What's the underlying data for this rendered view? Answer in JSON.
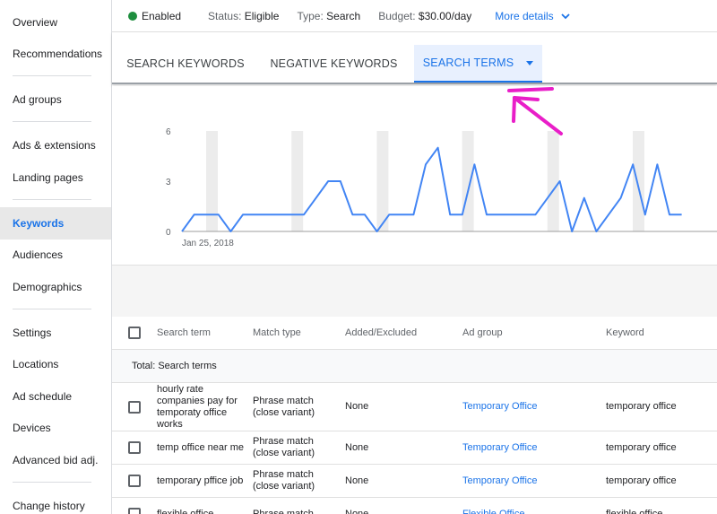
{
  "sidebar": {
    "items": [
      {
        "label": "Overview"
      },
      {
        "label": "Recommendations"
      },
      {
        "label": "Ad groups"
      },
      {
        "label": "Ads & extensions"
      },
      {
        "label": "Landing pages"
      },
      {
        "label": "Keywords"
      },
      {
        "label": "Audiences"
      },
      {
        "label": "Demographics"
      },
      {
        "label": "Settings"
      },
      {
        "label": "Locations"
      },
      {
        "label": "Ad schedule"
      },
      {
        "label": "Devices"
      },
      {
        "label": "Advanced bid adj."
      },
      {
        "label": "Change history"
      }
    ],
    "active": "Keywords"
  },
  "status": {
    "enabled": "Enabled",
    "status_label": "Status:",
    "status_value": "Eligible",
    "type_label": "Type:",
    "type_value": "Search",
    "budget_label": "Budget:",
    "budget_value": "$30.00/day",
    "more_details": "More details"
  },
  "tabs": [
    {
      "label": "SEARCH KEYWORDS"
    },
    {
      "label": "NEGATIVE KEYWORDS"
    },
    {
      "label": "SEARCH TERMS"
    }
  ],
  "chart_data": {
    "type": "line",
    "ylim": [
      0,
      6
    ],
    "y_ticks": [
      "0",
      "3",
      "6"
    ],
    "x_start_label": "Jan 25, 2018",
    "values": [
      0,
      1,
      1,
      1,
      0,
      1,
      1,
      1,
      1,
      1,
      1,
      2,
      3,
      3,
      1,
      1,
      0,
      1,
      1,
      1,
      4,
      5,
      1,
      1,
      4,
      1,
      1,
      1,
      1,
      1,
      2,
      3,
      0,
      2,
      0,
      1,
      2,
      4,
      1,
      4,
      1,
      1
    ],
    "color": "#4285f4"
  },
  "table": {
    "headers": {
      "search_term": "Search term",
      "match_type": "Match type",
      "added_excluded": "Added/Excluded",
      "ad_group": "Ad group",
      "keyword": "Keyword"
    },
    "total_label": "Total: Search terms",
    "rows": [
      {
        "search_term": "hourly rate companies pay for temporaty office works",
        "match_type": "Phrase match (close variant)",
        "added_excluded": "None",
        "ad_group": "Temporary Office",
        "keyword": "temporary office"
      },
      {
        "search_term": "temp office near me",
        "match_type": "Phrase match (close variant)",
        "added_excluded": "None",
        "ad_group": "Temporary Office",
        "keyword": "temporary office"
      },
      {
        "search_term": "temporary pffice job",
        "match_type": "Phrase match (close variant)",
        "added_excluded": "None",
        "ad_group": "Temporary Office",
        "keyword": "temporary office"
      },
      {
        "search_term": "flexible office",
        "match_type": "Phrase match",
        "added_excluded": "None",
        "ad_group": "Flexible Office",
        "keyword": "flexible office"
      }
    ]
  },
  "colors": {
    "accent": "#1a73e8",
    "enabled_dot": "#1e8e3e",
    "annotation": "#e91ec8"
  }
}
